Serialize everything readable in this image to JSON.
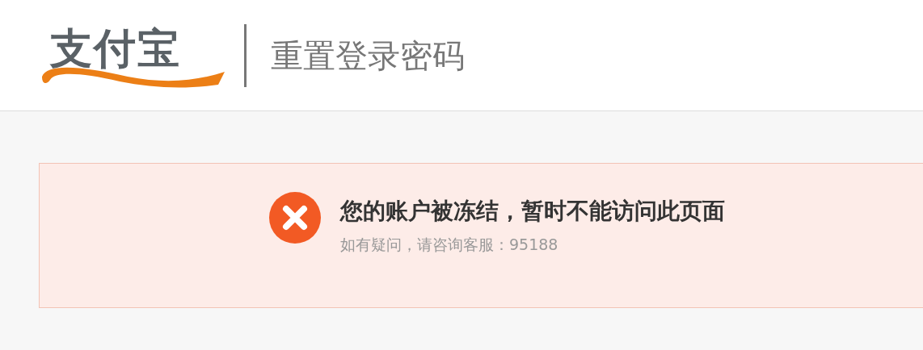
{
  "header": {
    "logo": "支付宝",
    "title": "重置登录密码"
  },
  "alert": {
    "kind": "error",
    "title": "您的账户被冻结，暂时不能访问此页面",
    "message": "如有疑问，请咨询客服：95188"
  }
}
